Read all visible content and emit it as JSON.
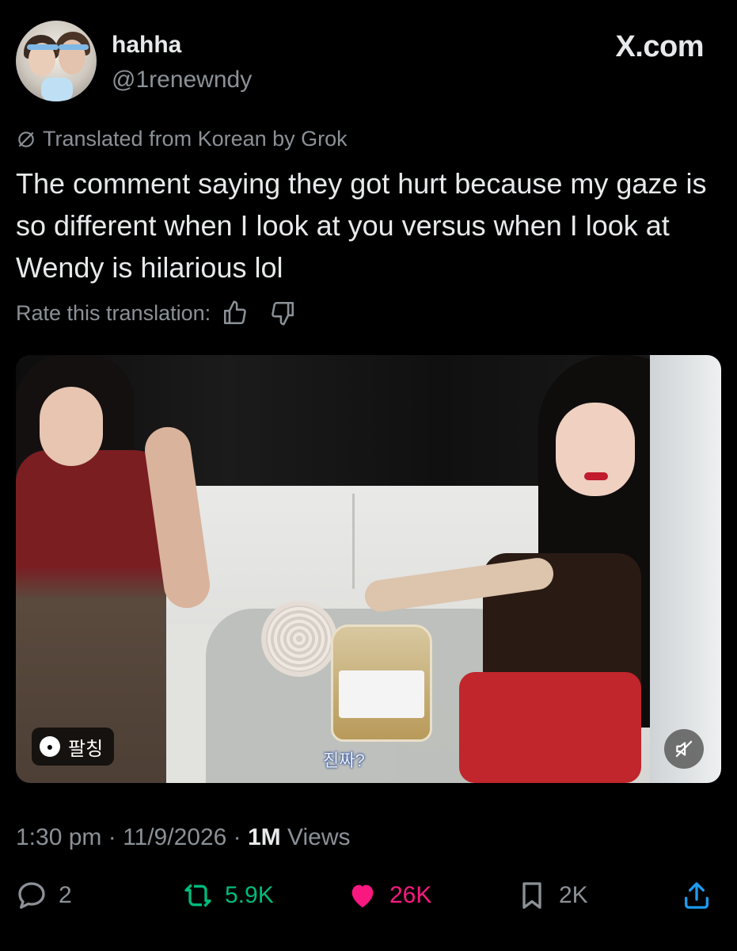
{
  "header": {
    "display_name": "hahha",
    "handle": "@1renewndy",
    "brand": "X.com"
  },
  "translation": {
    "notice": "Translated from Korean by Grok",
    "rate_label": "Rate this translation:"
  },
  "tweet": {
    "text": "The comment saying they got hurt because my gaze is so different when I look at you versus when I look at Wendy is hilarious lol"
  },
  "media": {
    "channel_badge": "팔칭",
    "subtitle": "진짜?"
  },
  "meta": {
    "time": "1:30 pm",
    "date": "11/9/2026",
    "views_count": "1M",
    "views_label": "Views"
  },
  "actions": {
    "replies": "2",
    "reposts": "5.9K",
    "likes": "26K",
    "bookmarks": "2K"
  },
  "colors": {
    "background": "#000000",
    "text": "#e7e9ea",
    "muted": "#8b9197",
    "repost": "#00ba7c",
    "like": "#f91880",
    "share": "#1d9bf0"
  }
}
